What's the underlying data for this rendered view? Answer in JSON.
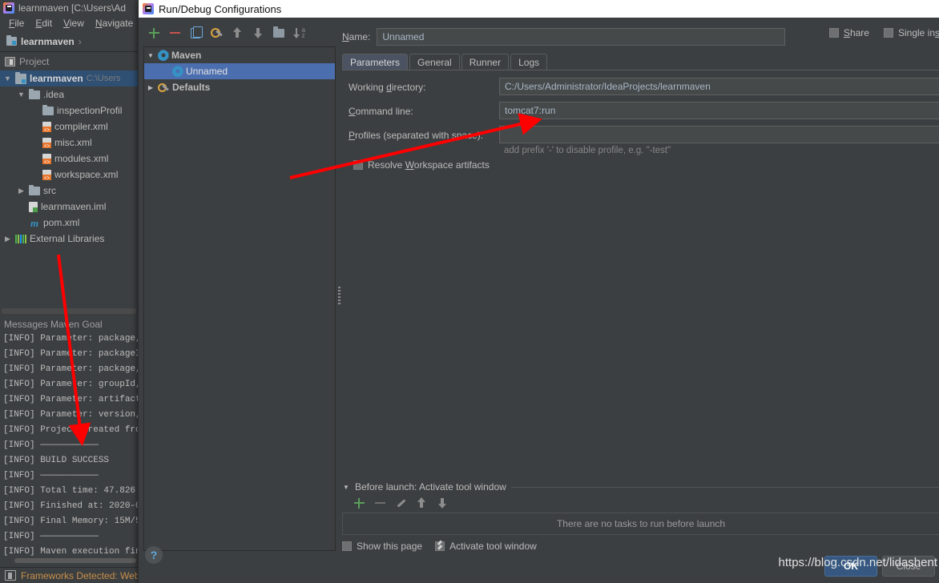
{
  "ide": {
    "window_title": "learnmaven [C:\\Users\\Ad",
    "menus": [
      "File",
      "Edit",
      "View",
      "Navigate"
    ],
    "breadcrumb": "learnmaven",
    "breadcrumb_sep": "›",
    "toolwindow_title": "Project",
    "project_tree": [
      {
        "label": "learnmaven",
        "sub": "C:\\Users",
        "icon": "module-icon",
        "twisty": "▼",
        "indent": 0,
        "bold": true,
        "selected": true
      },
      {
        "label": ".idea",
        "sub": "",
        "icon": "folder-icon",
        "twisty": "▼",
        "indent": 1,
        "bold": false,
        "selected": false
      },
      {
        "label": "inspectionProfil",
        "sub": "",
        "icon": "folder-icon",
        "twisty": "",
        "indent": 2,
        "bold": false,
        "selected": false
      },
      {
        "label": "compiler.xml",
        "sub": "",
        "icon": "xml-file-icon",
        "twisty": "",
        "indent": 2,
        "bold": false,
        "selected": false
      },
      {
        "label": "misc.xml",
        "sub": "",
        "icon": "xml-file-icon",
        "twisty": "",
        "indent": 2,
        "bold": false,
        "selected": false
      },
      {
        "label": "modules.xml",
        "sub": "",
        "icon": "xml-file-icon",
        "twisty": "",
        "indent": 2,
        "bold": false,
        "selected": false
      },
      {
        "label": "workspace.xml",
        "sub": "",
        "icon": "xml-file-icon",
        "twisty": "",
        "indent": 2,
        "bold": false,
        "selected": false
      },
      {
        "label": "src",
        "sub": "",
        "icon": "folder-icon",
        "twisty": "▶",
        "indent": 1,
        "bold": false,
        "selected": false
      },
      {
        "label": "learnmaven.iml",
        "sub": "",
        "icon": "iml-file-icon",
        "twisty": "",
        "indent": 1,
        "bold": false,
        "selected": false
      },
      {
        "label": "pom.xml",
        "sub": "",
        "icon": "maven-pom-icon",
        "twisty": "",
        "indent": 1,
        "bold": false,
        "selected": false
      },
      {
        "label": "External Libraries",
        "sub": "",
        "icon": "library-icon",
        "twisty": "▶",
        "indent": 0,
        "bold": false,
        "selected": false
      }
    ],
    "messages_title": "Messages Maven Goal",
    "console_lines": [
      "[INFO] Parameter: package,",
      "[INFO] Parameter: packageI",
      "[INFO] Parameter: package,",
      "[INFO] Parameter: groupId,",
      "[INFO] Parameter: artifact",
      "[INFO] Parameter: version,",
      "[INFO] Project created fro",
      "[INFO] ———————————",
      "[INFO] BUILD SUCCESS",
      "[INFO] ———————————",
      "[INFO] Total time: 47.826",
      "[INFO] Finished at: 2020-0",
      "[INFO] Final Memory: 15M/5",
      "[INFO] ———————————",
      "[INFO] Maven execution fin"
    ],
    "statusbar": "Frameworks Detected: Web framework is detected. Configure (a minute ago)"
  },
  "dialog": {
    "title": "Run/Debug Configurations",
    "toolbar": [
      {
        "name": "add-configuration-button",
        "icon": "plus-icon"
      },
      {
        "name": "remove-configuration-button",
        "icon": "minus-icon"
      },
      {
        "name": "copy-configuration-button",
        "icon": "copy-icon"
      },
      {
        "name": "edit-templates-button",
        "icon": "wrench-icon"
      },
      {
        "name": "move-up-button",
        "icon": "arrow-up-icon"
      },
      {
        "name": "move-down-button",
        "icon": "arrow-down-icon"
      },
      {
        "name": "create-folder-button",
        "icon": "folder-icon"
      },
      {
        "name": "sort-configurations-button",
        "icon": "sort-az-icon"
      }
    ],
    "config_tree": [
      {
        "label": "Maven",
        "twisty": "▼",
        "icon": "gear-icon",
        "indent": 0,
        "bold": true,
        "selected": false
      },
      {
        "label": "Unnamed",
        "twisty": "",
        "icon": "gear-icon",
        "indent": 1,
        "bold": false,
        "selected": true
      },
      {
        "label": "Defaults",
        "twisty": "▶",
        "icon": "defaults-icon",
        "indent": 0,
        "bold": true,
        "selected": false
      }
    ],
    "name_label": "Name:",
    "name_value": "Unnamed",
    "share_label": "Share",
    "share_checked": false,
    "single_instance_label": "Single ins",
    "single_instance_checked": false,
    "tabs": [
      {
        "label": "Parameters",
        "active": true
      },
      {
        "label": "General",
        "active": false
      },
      {
        "label": "Runner",
        "active": false
      },
      {
        "label": "Logs",
        "active": false
      }
    ],
    "parameters": {
      "working_directory_label": "Working directory:",
      "working_directory_value": "C:/Users/Administrator/IdeaProjects/learnmaven",
      "command_line_label": "Command line:",
      "command_line_value": "tomcat7:run",
      "profiles_label": "Profiles (separated with space):",
      "profiles_value": "",
      "profiles_hint": "add prefix '-' to disable profile, e.g. \"-test\"",
      "resolve_workspace_label": "Resolve Workspace artifacts",
      "resolve_workspace_checked": false
    },
    "before_launch": {
      "title": "Before launch: Activate tool window",
      "empty_text": "There are no tasks to run before launch",
      "toolbar": [
        {
          "name": "add-task-button",
          "icon": "plus-icon"
        },
        {
          "name": "remove-task-button",
          "icon": "minus-icon"
        },
        {
          "name": "edit-task-button",
          "icon": "pencil-icon"
        },
        {
          "name": "move-task-up-button",
          "icon": "arrow-up-icon"
        },
        {
          "name": "move-task-down-button",
          "icon": "arrow-down-icon"
        }
      ],
      "show_this_page_label": "Show this page",
      "show_this_page_checked": false,
      "activate_tool_window_label": "Activate tool window",
      "activate_tool_window_checked": true
    },
    "help_glyph": "?",
    "ok_label": "OK",
    "close_label": "Close"
  },
  "watermark": "https://blog.csdn.net/lidashent",
  "colors": {
    "background": "#3c3f41",
    "selection_blue": "#4b6eaf",
    "tab_active": "#4b5362",
    "accent_link": "#3592c4",
    "annotation_red": "#fe0000",
    "ok_button": "#365880"
  }
}
